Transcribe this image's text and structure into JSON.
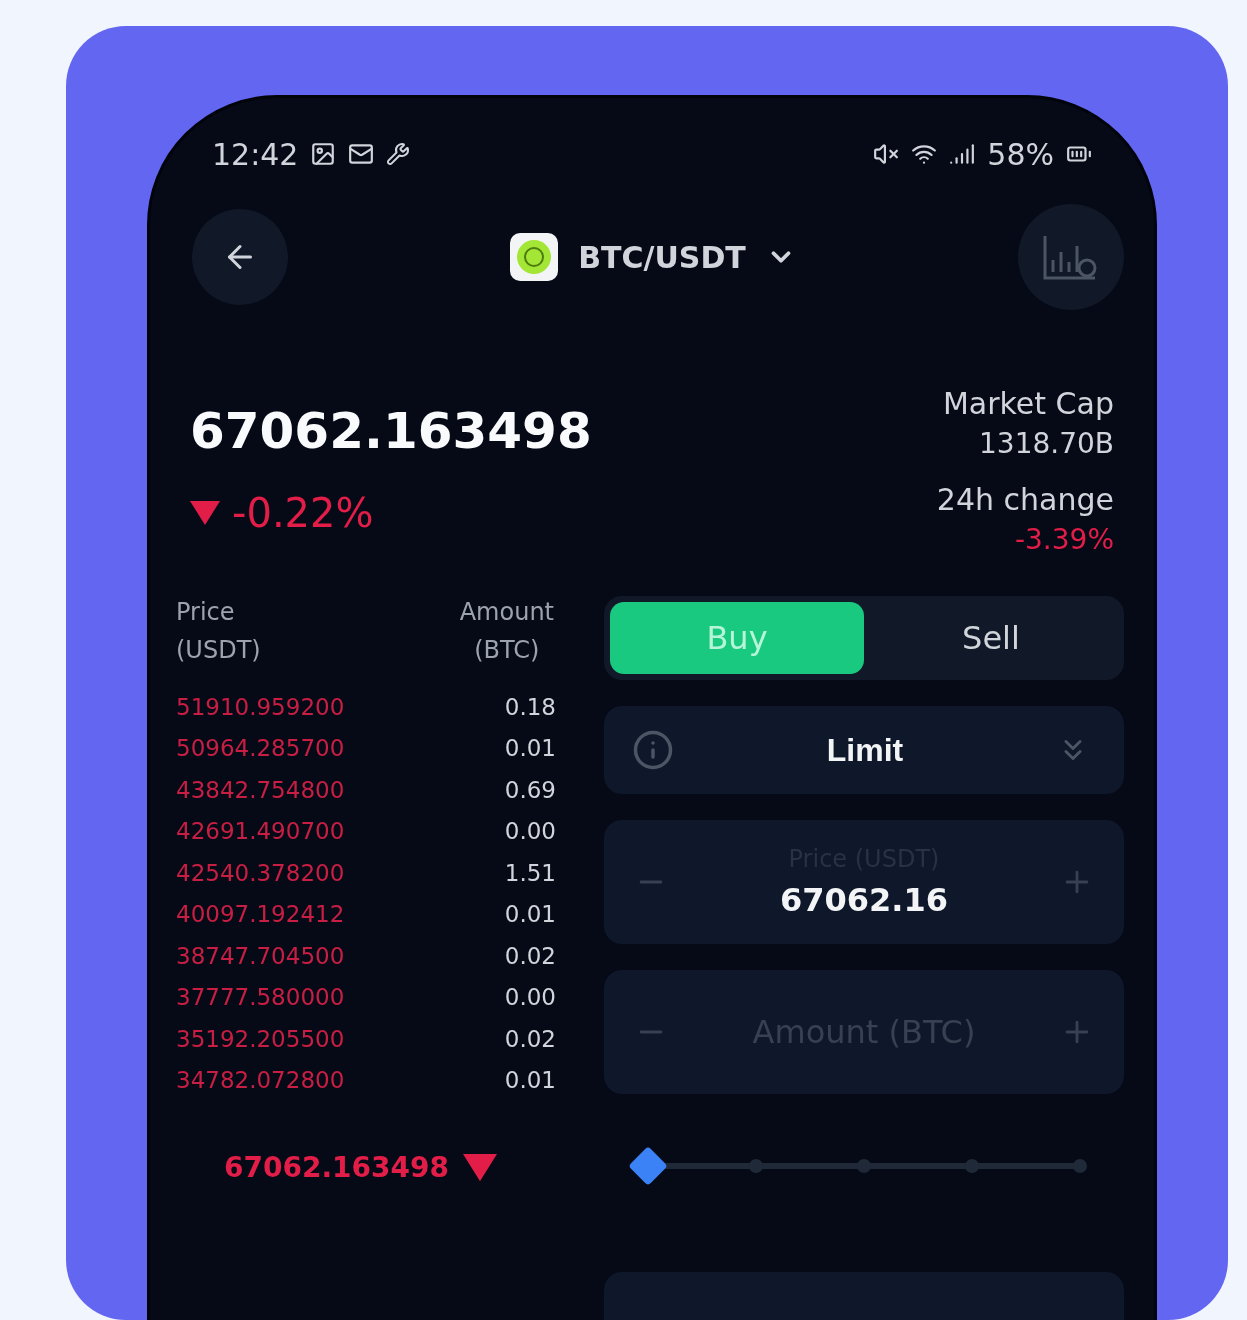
{
  "status_bar": {
    "time": "12:42",
    "battery": "58%"
  },
  "header": {
    "pair": "BTC/USDT"
  },
  "ticker": {
    "price": "67062.163498",
    "change": "-0.22%",
    "falling": true,
    "stats": [
      {
        "label": "Market Cap",
        "value": "1318.70B",
        "negative": false
      },
      {
        "label": "24h change",
        "value": "-3.39%",
        "negative": true
      }
    ]
  },
  "order_book": {
    "columns": [
      {
        "label": "Price",
        "unit": "(USDT)"
      },
      {
        "label": "Amount",
        "unit": "(BTC)"
      }
    ],
    "asks": [
      {
        "price": "51910.959200",
        "amount": "0.18"
      },
      {
        "price": "50964.285700",
        "amount": "0.01"
      },
      {
        "price": "43842.754800",
        "amount": "0.69"
      },
      {
        "price": "42691.490700",
        "amount": "0.00"
      },
      {
        "price": "42540.378200",
        "amount": "1.51"
      },
      {
        "price": "40097.192412",
        "amount": "0.01"
      },
      {
        "price": "38747.704500",
        "amount": "0.02"
      },
      {
        "price": "37777.580000",
        "amount": "0.00"
      },
      {
        "price": "35192.205500",
        "amount": "0.02"
      },
      {
        "price": "34782.072800",
        "amount": "0.01"
      }
    ],
    "last_price": "67062.163498",
    "last_falling": true
  },
  "order_form": {
    "sides": [
      {
        "label": "Buy",
        "selected": true
      },
      {
        "label": "Sell",
        "selected": false
      }
    ],
    "order_type": "Limit",
    "price_field": {
      "label": "Price (USDT)",
      "value": "67062.16"
    },
    "amount_field": {
      "placeholder": "Amount (BTC)"
    },
    "slider": {
      "level": 0
    }
  }
}
